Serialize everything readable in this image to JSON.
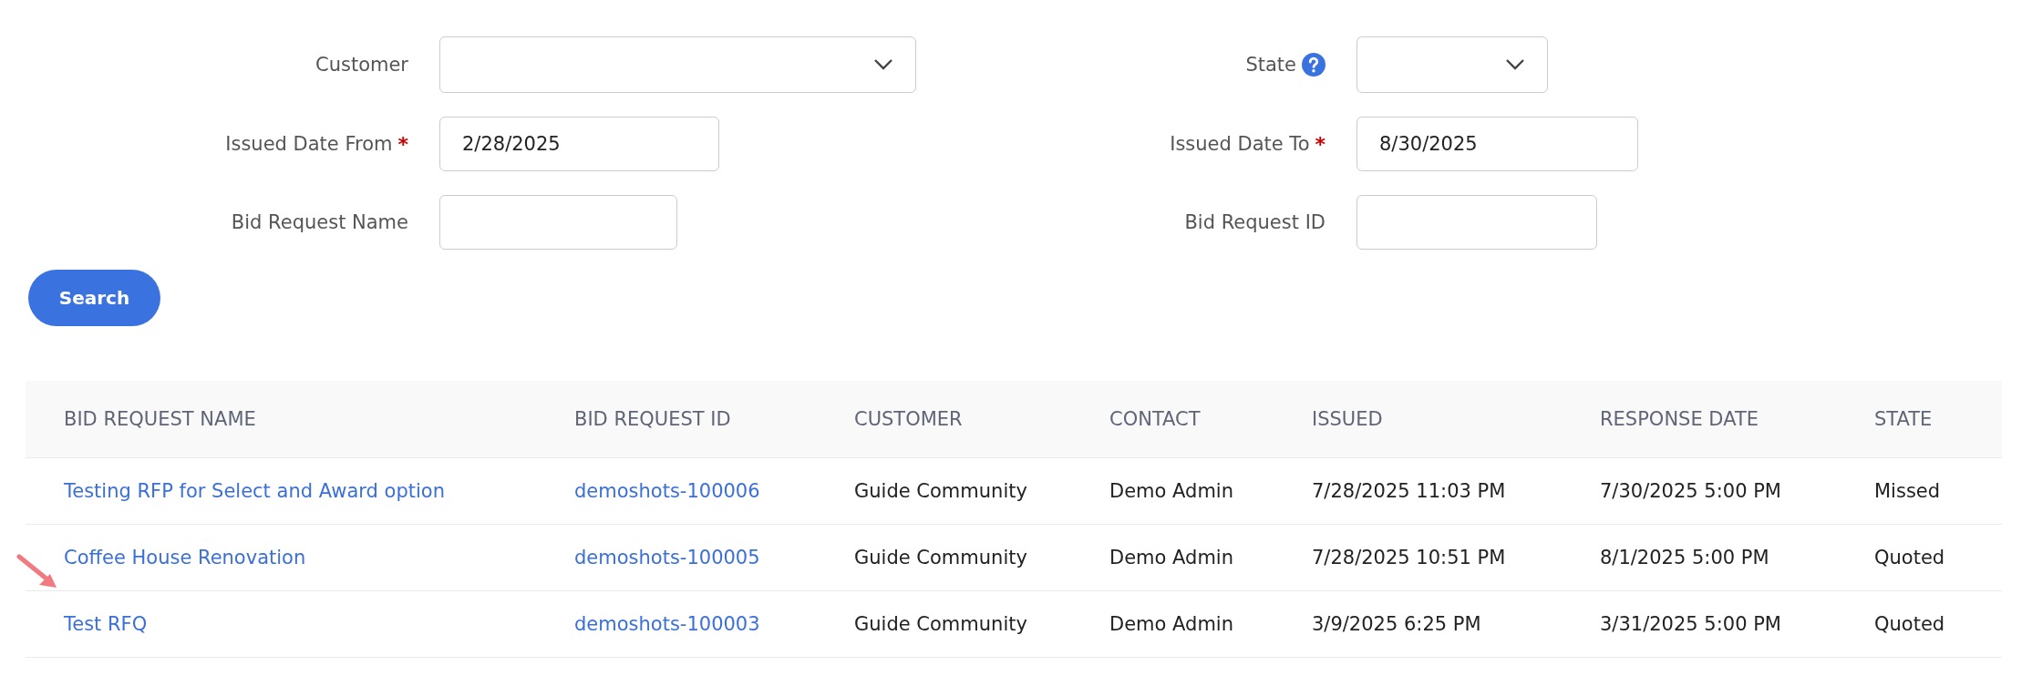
{
  "filters": [
    {
      "label": "Customer",
      "kind": "select"
    },
    {
      "label": "State",
      "kind": "select",
      "help": true
    },
    {
      "label": "Issued Date From",
      "kind": "text",
      "required_mark": "*",
      "value": "2/28/2025"
    },
    {
      "label": "Issued Date To",
      "kind": "text",
      "required_mark": "*",
      "value": "8/30/2025"
    },
    {
      "label": "Bid Request Name",
      "kind": "text"
    },
    {
      "label": "Bid Request ID",
      "kind": "text"
    }
  ],
  "search_button": "Search",
  "table": {
    "columns": [
      "BID REQUEST NAME",
      "BID REQUEST ID",
      "CUSTOMER",
      "CONTACT",
      "ISSUED",
      "RESPONSE DATE",
      "STATE"
    ],
    "rows": [
      {
        "cells": [
          "Testing RFP for Select and Award option",
          "demoshots-100006",
          "Guide Community",
          "Demo Admin",
          "7/28/2025 11:03 PM",
          "7/30/2025 5:00 PM",
          "Missed"
        ]
      },
      {
        "cells": [
          "Coffee House Renovation",
          "demoshots-100005",
          "Guide Community",
          "Demo Admin",
          "7/28/2025 10:51 PM",
          "8/1/2025 5:00 PM",
          "Quoted"
        ]
      },
      {
        "cells": [
          "Test RFQ",
          "demoshots-100003",
          "Guide Community",
          "Demo Admin",
          "3/9/2025 6:25 PM",
          "3/31/2025 5:00 PM",
          "Quoted"
        ]
      }
    ]
  }
}
